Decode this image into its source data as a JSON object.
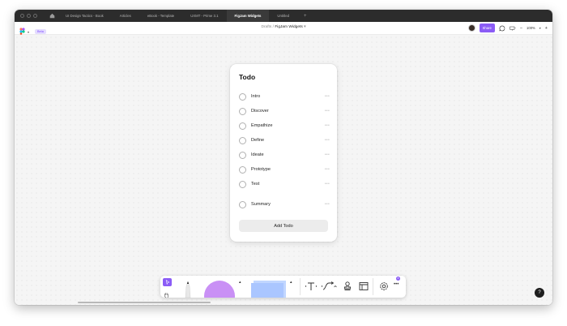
{
  "tabs": [
    {
      "label": "UI Design Tactics - Book",
      "active": false
    },
    {
      "label": "Articles",
      "active": false
    },
    {
      "label": "eBook - Template",
      "active": false
    },
    {
      "label": "UXMT - Prime 3.1",
      "active": false
    },
    {
      "label": "FigJam Widgets",
      "active": true
    },
    {
      "label": "Untitled",
      "active": false
    }
  ],
  "tab_add": "+",
  "toolbar": {
    "beta_label": "Beta",
    "breadcrumb_parent": "Drafts",
    "breadcrumb_sep": "/",
    "file_name": "FigJam Widgets",
    "share_label": "Share",
    "zoom_level": "100%",
    "zoom_minus": "−",
    "zoom_plus": "+"
  },
  "todo": {
    "title": "Todo",
    "items": [
      {
        "label": "Intro",
        "checked": false
      },
      {
        "label": "Discover",
        "checked": false
      },
      {
        "label": "Empathize",
        "checked": false
      },
      {
        "label": "Define",
        "checked": false
      },
      {
        "label": "Ideate",
        "checked": false
      },
      {
        "label": "Prototype",
        "checked": false
      },
      {
        "label": "Test",
        "checked": false
      },
      {
        "label": "Summary",
        "checked": false
      }
    ],
    "item_menu": "•••",
    "add_label": "Add Todo"
  },
  "bottom_toolbar": {
    "text_tool_glyph": "T",
    "more_glyph": "•••",
    "badge_count": "8"
  },
  "help_label": "?",
  "colors": {
    "accent": "#8b5cf6",
    "shape_fill": "#c990f5",
    "sticky_fill": "#aac6ff",
    "tab_bar": "#2c2c2c"
  }
}
